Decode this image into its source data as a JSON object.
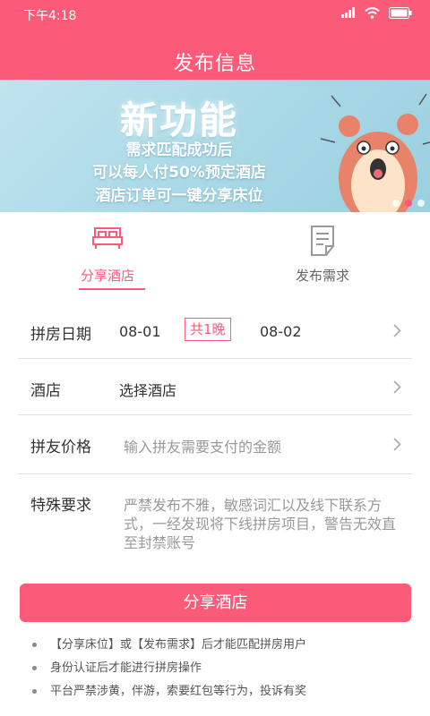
{
  "status_bar": {
    "time": "下午4:18"
  },
  "header": {
    "title": "发布信息"
  },
  "banner": {
    "headline": "新功能",
    "lines": [
      "需求匹配成功后",
      "可以每人付50%预定酒店",
      "酒店订单可一键分享床位"
    ]
  },
  "tabs": [
    {
      "label": "分享酒店",
      "icon": "bed-icon",
      "active": true
    },
    {
      "label": "发布需求",
      "icon": "document-icon",
      "active": false
    }
  ],
  "form": {
    "date": {
      "label": "拼房日期",
      "start": "08-01",
      "nights": "共1晚",
      "end": "08-02"
    },
    "hotel": {
      "label": "酒店",
      "value": "选择酒店"
    },
    "price": {
      "label": "拼友价格",
      "placeholder": "输入拼友需要支付的金额"
    },
    "special": {
      "label": "特殊要求",
      "placeholder": "严禁发布不雅，敏感词汇以及线下联系方式，一经发现将下线拼房项目，警告无效直至封禁账号"
    }
  },
  "submit_label": "分享酒店",
  "tips": [
    "【分享床位】或【发布需求】后才能匹配拼房用户",
    "身份认证后才能进行拼房操作",
    "平台严禁涉黄，伴游，索要红包等行为，投诉有奖"
  ],
  "colors": {
    "accent": "#fb5a78"
  }
}
